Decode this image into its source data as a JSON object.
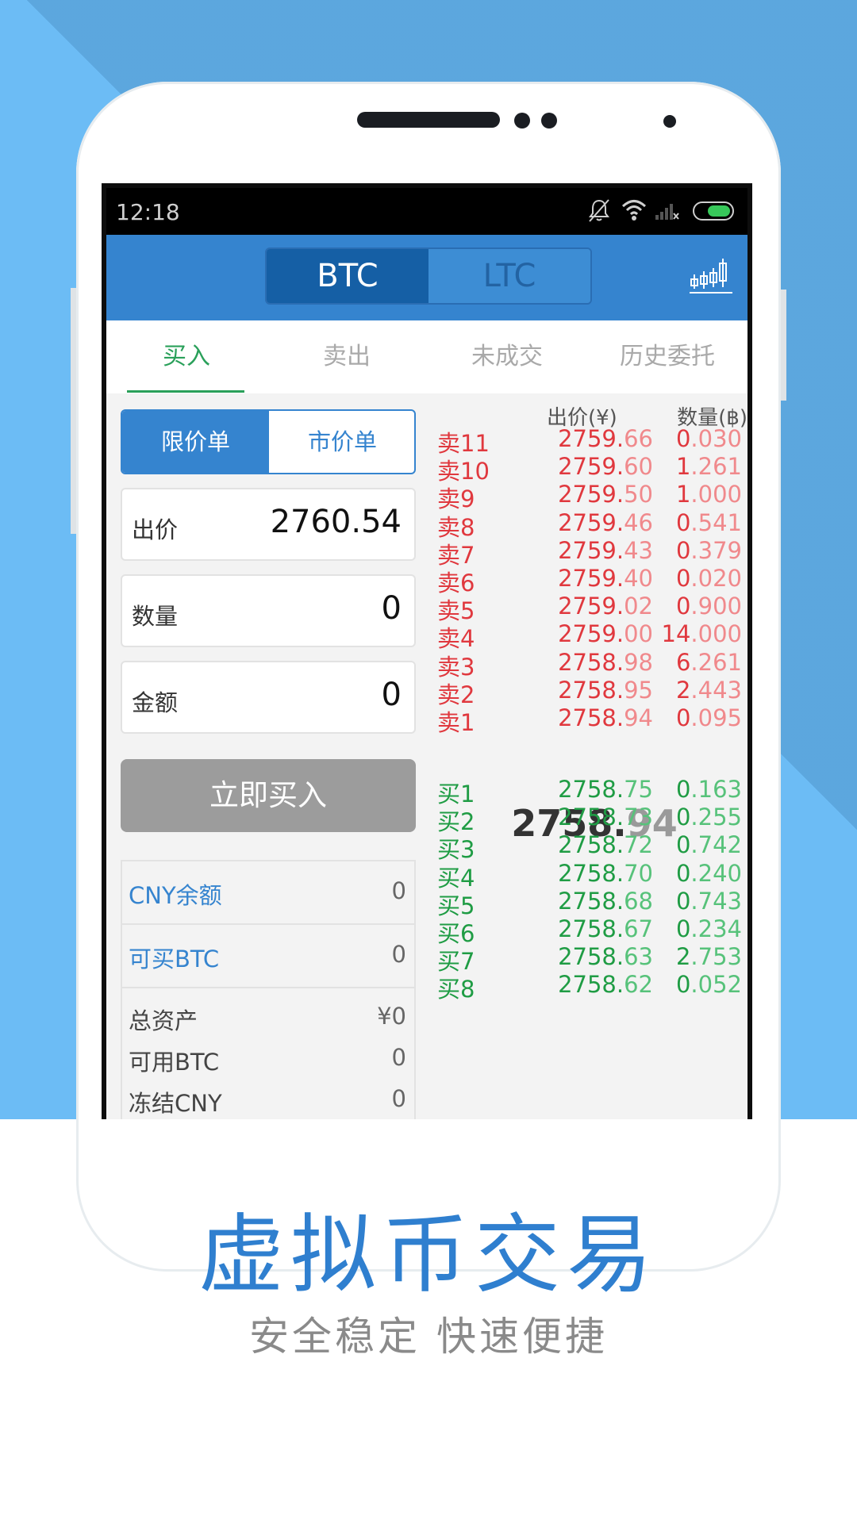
{
  "status_bar": {
    "time": "12:18"
  },
  "header": {
    "coin_tabs": [
      {
        "label": "BTC",
        "active": true
      },
      {
        "label": "LTC",
        "active": false
      }
    ],
    "chart_icon": "candlestick-chart-icon"
  },
  "tabs": [
    {
      "label": "买入",
      "active": true
    },
    {
      "label": "卖出",
      "active": false
    },
    {
      "label": "未成交",
      "active": false
    },
    {
      "label": "历史委托",
      "active": false
    }
  ],
  "order_form": {
    "order_types": [
      "限价单",
      "市价单"
    ],
    "price_label": "出价",
    "price_value": "2760.54",
    "quantity_label": "数量",
    "quantity_value": "0",
    "amount_label": "金额",
    "amount_value": "0",
    "submit_label": "立即买入"
  },
  "balances": {
    "cny_label": "CNY余额",
    "cny_value": "0",
    "buyable_label": "可买BTC",
    "buyable_value": "0",
    "total_label": "总资产",
    "total_value": "¥0",
    "avail_btc_label": "可用BTC",
    "avail_btc_value": "0",
    "frozen_cny_label": "冻结CNY",
    "frozen_cny_value": "0"
  },
  "order_book": {
    "price_header": "出价(¥)",
    "qty_header": "数量(฿)",
    "sell": [
      {
        "label": "卖11",
        "price_main": "2759.",
        "price_dec": "66",
        "qty_main": "0",
        "qty_dec": ".030"
      },
      {
        "label": "卖10",
        "price_main": "2759.",
        "price_dec": "60",
        "qty_main": "1",
        "qty_dec": ".261"
      },
      {
        "label": "卖9",
        "price_main": "2759.",
        "price_dec": "50",
        "qty_main": "1",
        "qty_dec": ".000"
      },
      {
        "label": "卖8",
        "price_main": "2759.",
        "price_dec": "46",
        "qty_main": "0",
        "qty_dec": ".541"
      },
      {
        "label": "卖7",
        "price_main": "2759.",
        "price_dec": "43",
        "qty_main": "0",
        "qty_dec": ".379"
      },
      {
        "label": "卖6",
        "price_main": "2759.",
        "price_dec": "40",
        "qty_main": "0",
        "qty_dec": ".020"
      },
      {
        "label": "卖5",
        "price_main": "2759.",
        "price_dec": "02",
        "qty_main": "0",
        "qty_dec": ".900"
      },
      {
        "label": "卖4",
        "price_main": "2759.",
        "price_dec": "00",
        "qty_main": "14",
        "qty_dec": ".000"
      },
      {
        "label": "卖3",
        "price_main": "2758.",
        "price_dec": "98",
        "qty_main": "6",
        "qty_dec": ".261"
      },
      {
        "label": "卖2",
        "price_main": "2758.",
        "price_dec": "95",
        "qty_main": "2",
        "qty_dec": ".443"
      },
      {
        "label": "卖1",
        "price_main": "2758.",
        "price_dec": "94",
        "qty_main": "0",
        "qty_dec": ".095"
      }
    ],
    "last_price_main": "2758.",
    "last_price_dec": "94",
    "buy": [
      {
        "label": "买1",
        "price_main": "2758.",
        "price_dec": "75",
        "qty_main": "0",
        "qty_dec": ".163"
      },
      {
        "label": "买2",
        "price_main": "2758.",
        "price_dec": "73",
        "qty_main": "0",
        "qty_dec": ".255"
      },
      {
        "label": "买3",
        "price_main": "2758.",
        "price_dec": "72",
        "qty_main": "0",
        "qty_dec": ".742"
      },
      {
        "label": "买4",
        "price_main": "2758.",
        "price_dec": "70",
        "qty_main": "0",
        "qty_dec": ".240"
      },
      {
        "label": "买5",
        "price_main": "2758.",
        "price_dec": "68",
        "qty_main": "0",
        "qty_dec": ".743"
      },
      {
        "label": "买6",
        "price_main": "2758.",
        "price_dec": "67",
        "qty_main": "0",
        "qty_dec": ".234"
      },
      {
        "label": "买7",
        "price_main": "2758.",
        "price_dec": "63",
        "qty_main": "2",
        "qty_dec": ".753"
      },
      {
        "label": "买8",
        "price_main": "2758.",
        "price_dec": "62",
        "qty_main": "0",
        "qty_dec": ".052"
      }
    ]
  },
  "promo": {
    "headline": "虚拟币交易",
    "subline": "安全稳定  快速便捷"
  },
  "colors": {
    "brand_blue": "#3584cf",
    "sell_red": "#e0383e",
    "buy_green": "#1f9c44",
    "background_blue": "#6cbcf5"
  }
}
